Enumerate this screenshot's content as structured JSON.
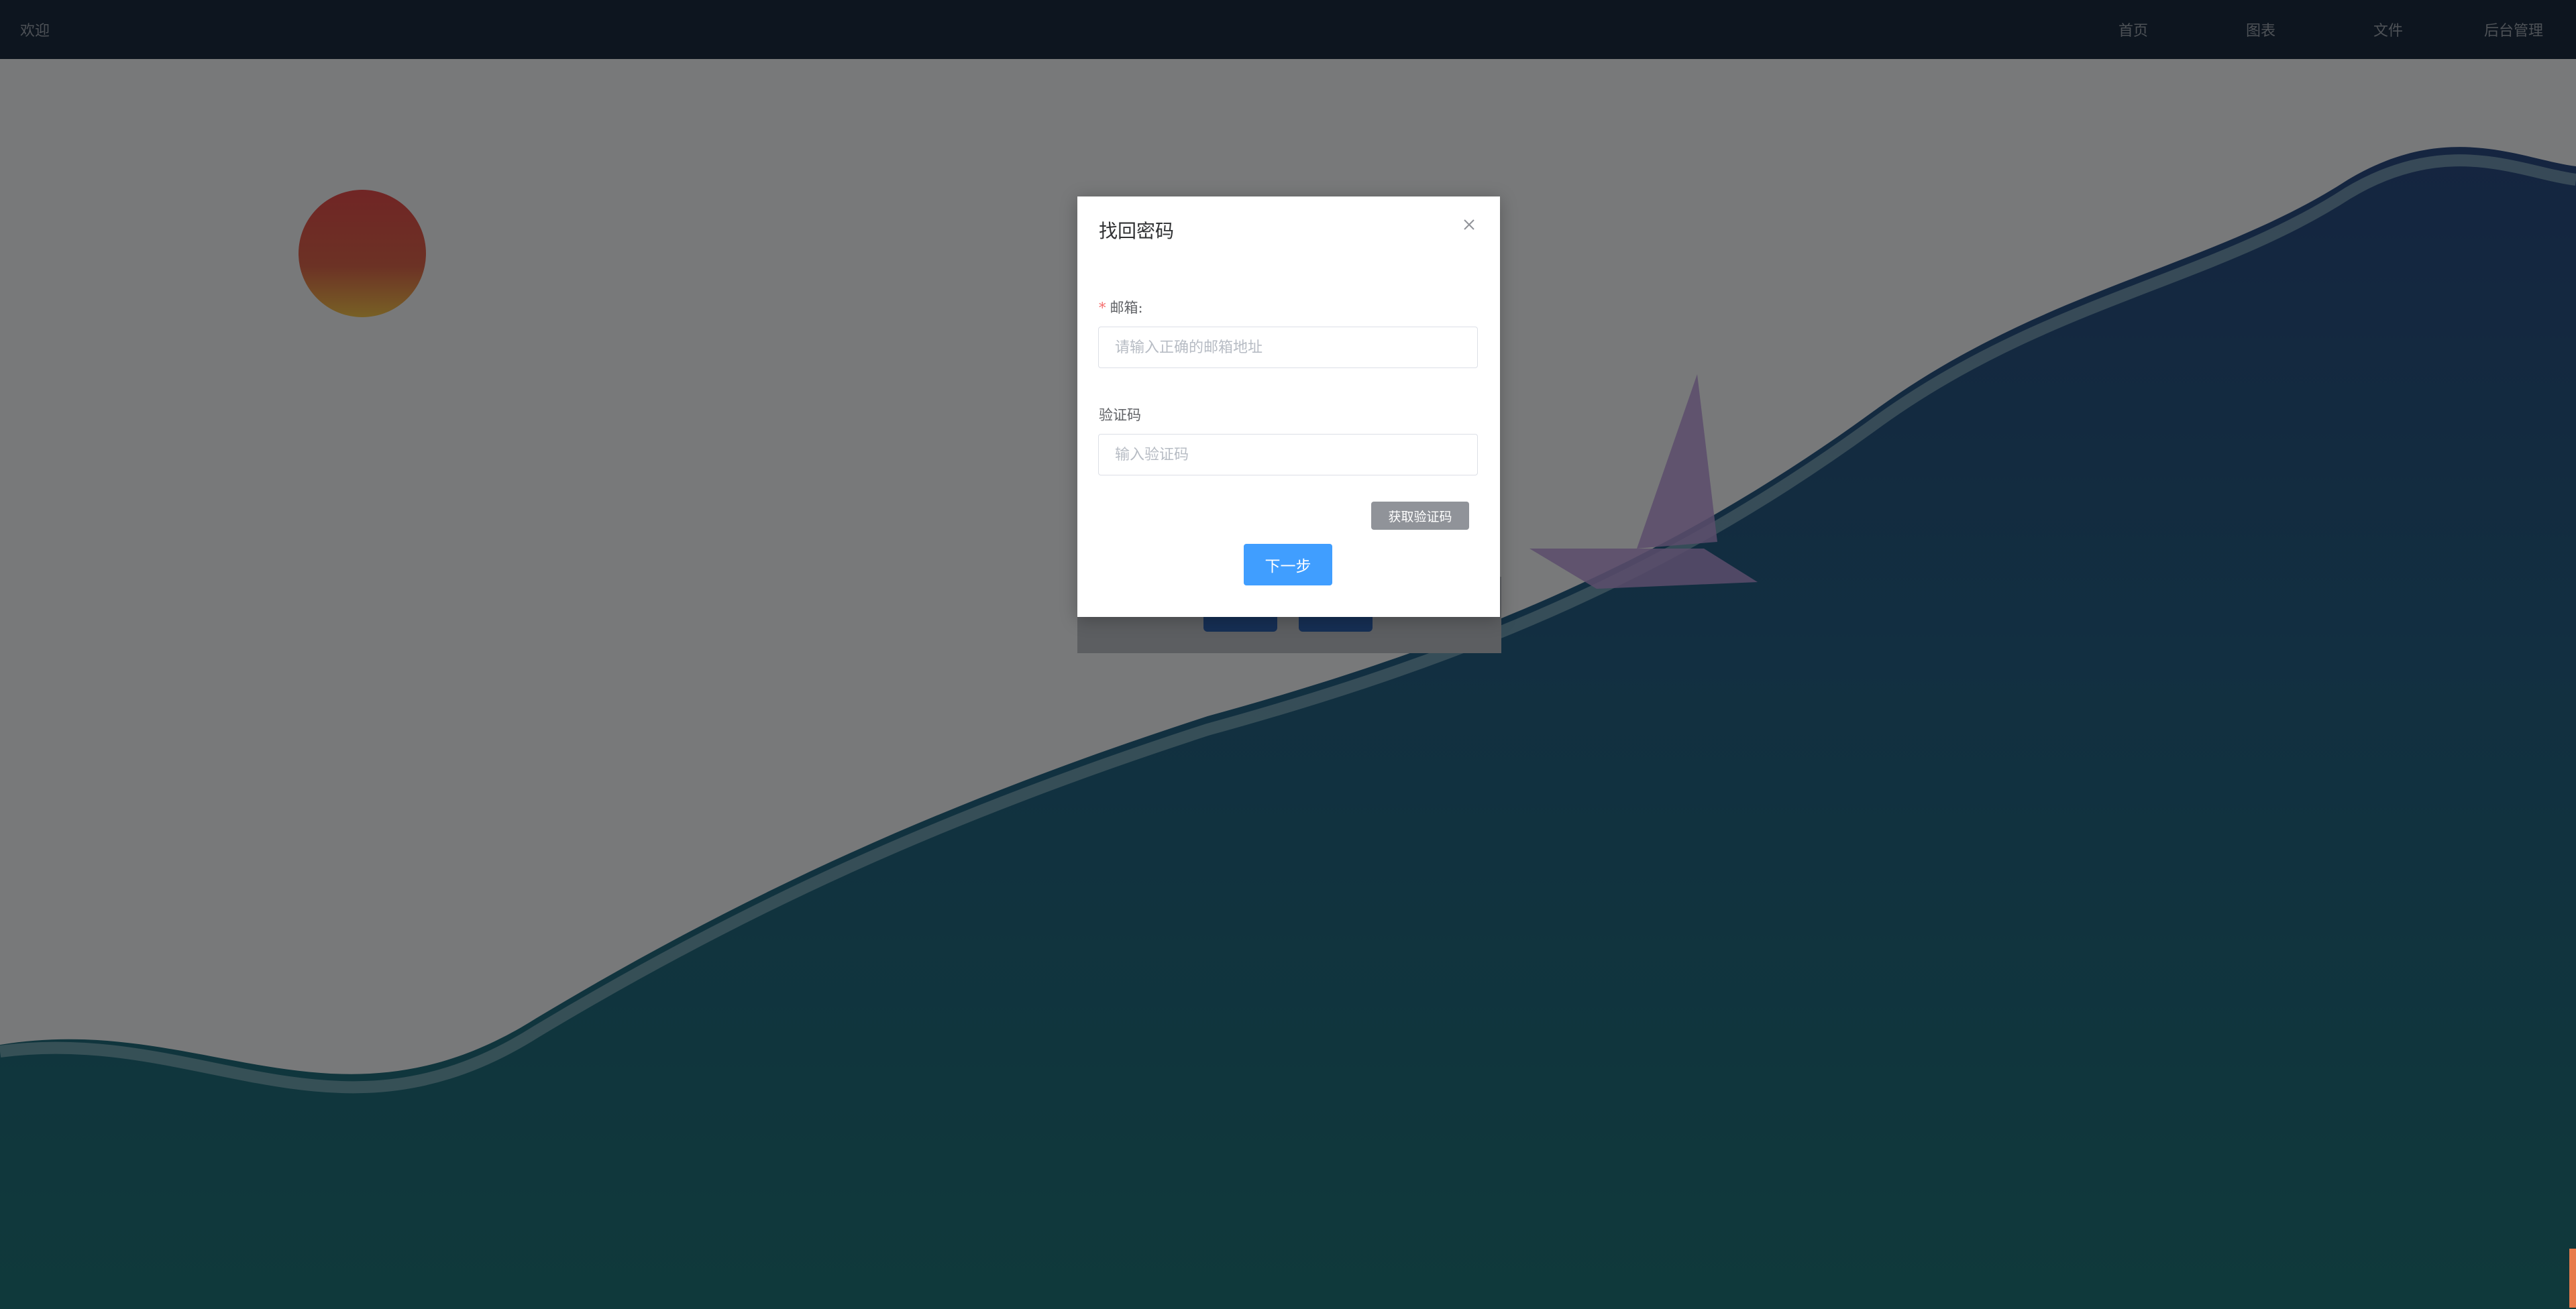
{
  "nav": {
    "brand": "欢迎",
    "items": [
      "首页",
      "图表",
      "文件",
      "后台管理"
    ]
  },
  "dialog": {
    "title": "找回密码",
    "email_label": "邮箱:",
    "email_placeholder": "请输入正确的邮箱地址",
    "code_label": "验证码",
    "code_placeholder": "输入验证码",
    "get_code_button": "获取验证码",
    "next_button": "下一步"
  },
  "colors": {
    "nav_bg": "#1b2b3f",
    "primary": "#409eff",
    "disabled_button": "#909399",
    "required_mark": "#f56c6c",
    "sea": "#1f6f75",
    "sun": "#e14b4b"
  }
}
